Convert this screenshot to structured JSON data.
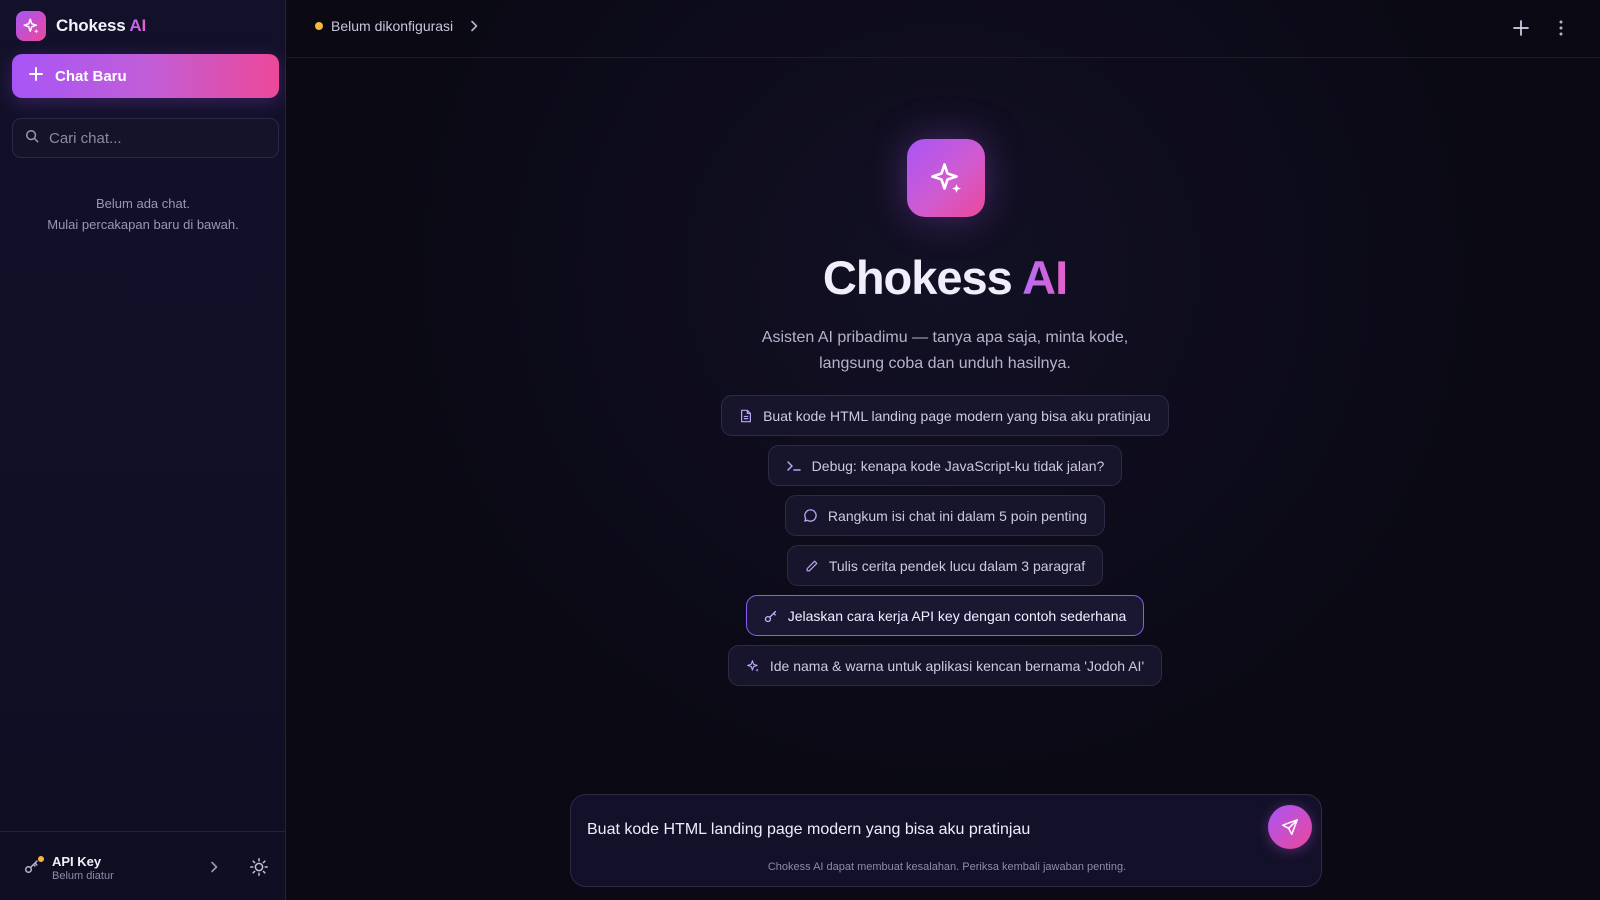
{
  "sidebar": {
    "brand": {
      "name": "Chokess",
      "accent": "AI"
    },
    "new_chat_label": "Chat Baru",
    "search_placeholder": "Cari chat...",
    "empty_line1": "Belum ada chat.",
    "empty_line2": "Mulai percakapan baru di bawah.",
    "api_key": {
      "title": "API Key",
      "subtitle": "Belum diatur"
    }
  },
  "topbar": {
    "status_text": "Belum dikonfigurasi"
  },
  "hero": {
    "title": "Chokess",
    "title_accent": "AI",
    "subtitle_line1": "Asisten AI pribadimu — tanya apa saja, minta kode,",
    "subtitle_line2": "langsung coba dan unduh hasilnya."
  },
  "suggestions": [
    {
      "icon": "document-icon",
      "label": "Buat kode HTML landing page modern yang bisa aku pratinjau"
    },
    {
      "icon": "terminal-icon",
      "label": "Debug: kenapa kode JavaScript-ku tidak jalan?"
    },
    {
      "icon": "chat-bubble-icon",
      "label": "Rangkum isi chat ini dalam 5 poin penting"
    },
    {
      "icon": "pencil-icon",
      "label": "Tulis cerita pendek lucu dalam 3 paragraf"
    },
    {
      "icon": "key-icon",
      "label": "Jelaskan cara kerja API key dengan contoh sederhana"
    },
    {
      "icon": "sparkle-icon",
      "label": "Ide nama & warna untuk aplikasi kencan bernama 'Jodoh AI'"
    }
  ],
  "composer": {
    "value": "Buat kode HTML landing page modern yang bisa aku pratinjau",
    "disclaimer": "Chokess AI dapat membuat kesalahan. Periksa kembali jawaban penting."
  },
  "colors": {
    "accent_start": "#a855f7",
    "accent_end": "#ec4899",
    "status_warning": "#f5b83b"
  }
}
